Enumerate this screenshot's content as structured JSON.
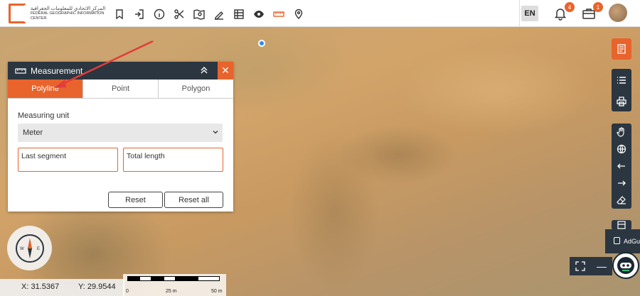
{
  "topbar": {
    "logo_text_ar": "المركز الاتحادي للمعلومات الجغرافية",
    "logo_text_en": "FEDERAL GEOGRAPHIC INFORMATION CENTER",
    "tools": [
      "bookmark-icon",
      "login-icon",
      "info-icon",
      "scissors-icon",
      "map-search-icon",
      "draw-icon",
      "table-icon",
      "eye-icon",
      "measure-icon",
      "location-pin-icon"
    ],
    "language": "EN",
    "notifications_count": "4",
    "briefcase_count": "1"
  },
  "panel": {
    "title": "Measurement",
    "tabs": [
      "Polyline",
      "Point",
      "Polygon"
    ],
    "measuring_unit_label": "Measuring unit",
    "unit_value": "Meter",
    "last_segment_label": "Last segment",
    "total_length_label": "Total length",
    "reset_label": "Reset",
    "reset_all_label": "Reset all"
  },
  "coords": {
    "x": "X: 31.5367",
    "y": "Y: 29.9544"
  },
  "scale": {
    "labels": [
      "0",
      "25 m",
      "50 m"
    ]
  },
  "adguard": {
    "label": "AdGu"
  },
  "colors": {
    "accent": "#e8642c",
    "dark": "#2b3640"
  }
}
